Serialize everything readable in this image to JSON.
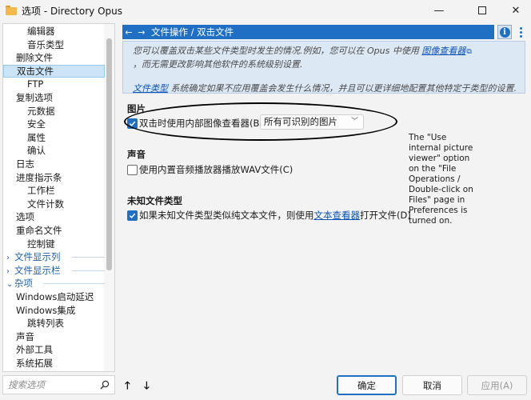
{
  "window": {
    "title": "选项 - Directory Opus",
    "minimize": "—",
    "close": "✕"
  },
  "sidebar": {
    "items": [
      {
        "label": "编辑器",
        "indent": 2,
        "kind": "item"
      },
      {
        "label": "音乐类型",
        "indent": 2,
        "kind": "item"
      },
      {
        "label": "删除文件",
        "indent": 1,
        "kind": "item"
      },
      {
        "label": "双击文件",
        "indent": 1,
        "kind": "selected"
      },
      {
        "label": "FTP",
        "indent": 2,
        "kind": "item"
      },
      {
        "label": "复制选项",
        "indent": 1,
        "kind": "item"
      },
      {
        "label": "元数据",
        "indent": 2,
        "kind": "item"
      },
      {
        "label": "安全",
        "indent": 2,
        "kind": "item"
      },
      {
        "label": "属性",
        "indent": 2,
        "kind": "item"
      },
      {
        "label": "确认",
        "indent": 2,
        "kind": "item"
      },
      {
        "label": "日志",
        "indent": 1,
        "kind": "item"
      },
      {
        "label": "进度指示条",
        "indent": 1,
        "kind": "item"
      },
      {
        "label": "工作栏",
        "indent": 2,
        "kind": "item"
      },
      {
        "label": "文件计数",
        "indent": 2,
        "kind": "item"
      },
      {
        "label": "选项",
        "indent": 1,
        "kind": "item"
      },
      {
        "label": "重命名文件",
        "indent": 1,
        "kind": "item"
      },
      {
        "label": "控制键",
        "indent": 2,
        "kind": "item"
      },
      {
        "label": "文件显示列",
        "indent": 1,
        "kind": "group",
        "chevron": "›"
      },
      {
        "label": "文件显示栏",
        "indent": 1,
        "kind": "group",
        "chevron": "›"
      },
      {
        "label": "杂项",
        "indent": 1,
        "kind": "group",
        "chevron": "⌄"
      },
      {
        "label": "Windows启动延迟",
        "indent": 1,
        "kind": "item"
      },
      {
        "label": "Windows集成",
        "indent": 1,
        "kind": "item"
      },
      {
        "label": "跳转列表",
        "indent": 2,
        "kind": "item"
      },
      {
        "label": "声音",
        "indent": 1,
        "kind": "item"
      },
      {
        "label": "外部工具",
        "indent": 1,
        "kind": "item"
      },
      {
        "label": "系统拓展",
        "indent": 1,
        "kind": "item"
      }
    ],
    "search_placeholder": "搜索选项"
  },
  "header": {
    "back": "←",
    "forward": "→",
    "breadcrumb": "文件操作 / 双击文件",
    "info": "i"
  },
  "description": {
    "line1_prefix": "您可以覆盖双击某些文件类型时发生的情况.例如，您可以在 Opus 中使用 ",
    "line1_link": "图像查看器",
    "line2": "，而无需更改影响其他软件的系统级别设置.",
    "line3_link": "文件类型",
    "line3_suffix": " 系统确定如果不应用覆盖会发生什么情况，并且可以更详细地配置其他特定于类型的设置."
  },
  "sections": {
    "image": {
      "title": "图片",
      "checkbox_label": "双击时使用内部图像查看器(B):",
      "checked": true,
      "select_value": "所有可识别的图片"
    },
    "sound": {
      "title": "声音",
      "checkbox_label": "使用内置音频播放器播放WAV文件(C)",
      "checked": false
    },
    "unknown": {
      "title": "未知文件类型",
      "checkbox_prefix": "如果未知文件类型类似纯文本文件，则使用",
      "checkbox_link": "文本查看器",
      "checkbox_suffix": "打开文件(D)",
      "checked": true
    }
  },
  "note": "The \"Use internal picture viewer\" option on the \"File Operations / Double-click on Files\" page in Preferences is turned on.",
  "footer": {
    "up": "🡑",
    "down": "🡓",
    "ok": "确定",
    "cancel": "取消",
    "apply": "应用(A)"
  },
  "colors": {
    "accent": "#1f6fc5",
    "link": "#0b54b8",
    "selection": "#cce4f7"
  }
}
